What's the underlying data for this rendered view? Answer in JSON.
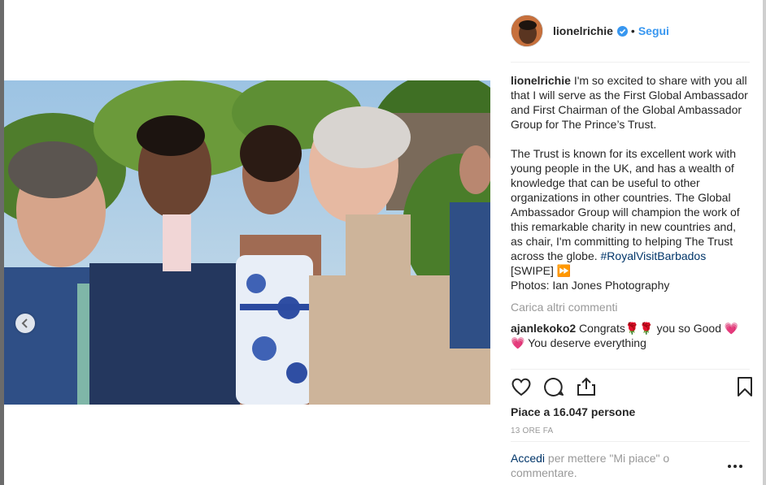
{
  "post": {
    "username": "lionelrichie",
    "follow_label": "Segui",
    "dot": "•",
    "caption_user": "lionelrichie",
    "caption_p1": "I'm so excited to share with you all that I will serve as the First Global Ambassador and First Chairman of the Global Ambassador Group for The Prince’s Trust.",
    "caption_p2_text": "The Trust is known for its excellent work with young people in the UK, and has a wealth of knowledge that can be useful to other organizations in other countries. The Global Ambassador Group will champion the work of this remarkable charity in new countries and, as chair, I'm committing to helping The Trust across the globe. ",
    "hashtag": "#RoyalVisitBarbados",
    "swipe": "[SWIPE] ⏩",
    "photos_credit": "Photos: Ian Jones Photography",
    "load_more": "Carica altri commenti",
    "comments": [
      {
        "user": "ajanlekoko2",
        "text": "Congrats🌹🌹 you so Good 💗💗 You deserve everything"
      }
    ],
    "likes": "Piace a 16.047 persone",
    "time": "13 ORE FA",
    "login_link": "Accedi",
    "login_rest": " per mettere \"Mi piace\" o commentare."
  },
  "icons": {
    "verified": "verified-badge-icon",
    "heart": "heart-icon",
    "comment": "comment-icon",
    "share": "share-icon",
    "bookmark": "bookmark-icon",
    "more": "more-options-icon",
    "prev": "chevron-left-icon"
  },
  "colors": {
    "accent": "#3897f0",
    "link": "#003569",
    "muted": "#999999",
    "text": "#262626"
  }
}
